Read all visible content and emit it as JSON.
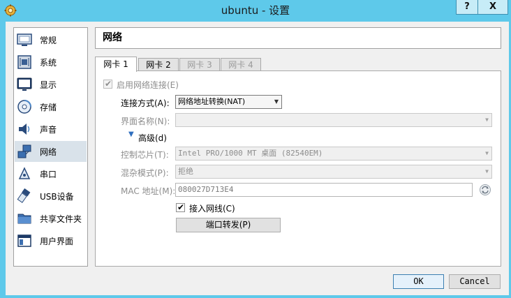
{
  "window": {
    "title": "ubuntu - 设置",
    "help_label": "?",
    "close_label": "X"
  },
  "sidebar": {
    "items": [
      {
        "label": "常规",
        "icon": "general-icon"
      },
      {
        "label": "系统",
        "icon": "system-icon"
      },
      {
        "label": "显示",
        "icon": "display-icon"
      },
      {
        "label": "存储",
        "icon": "storage-icon"
      },
      {
        "label": "声音",
        "icon": "audio-icon"
      },
      {
        "label": "网络",
        "icon": "network-icon",
        "selected": true
      },
      {
        "label": "串口",
        "icon": "serial-port-icon"
      },
      {
        "label": "USB设备",
        "icon": "usb-icon"
      },
      {
        "label": "共享文件夹",
        "icon": "shared-folder-icon"
      },
      {
        "label": "用户界面",
        "icon": "user-interface-icon"
      }
    ]
  },
  "section": {
    "title": "网络"
  },
  "tabs": [
    {
      "label": "网卡 1",
      "active": true
    },
    {
      "label": "网卡 2",
      "active": false
    },
    {
      "label": "网卡 3",
      "disabled": true
    },
    {
      "label": "网卡 4",
      "disabled": true
    }
  ],
  "adapter": {
    "enable_label": "启用网络连接(E)",
    "enable_checked": true,
    "attached_label": "连接方式(A):",
    "attached_value": "网络地址转换(NAT)",
    "name_label": "界面名称(N):",
    "name_value": "",
    "advanced_label": "高级(d)",
    "chip_label": "控制芯片(T):",
    "chip_value": "Intel PRO/1000 MT 桌面 (82540EM)",
    "promisc_label": "混杂模式(P):",
    "promisc_value": "拒绝",
    "mac_label": "MAC 地址(M):",
    "mac_value": "080027D713E4",
    "cable_label": "接入网线(C)",
    "cable_checked": true,
    "port_forward_label": "端口转发(P)"
  },
  "footer": {
    "ok_label": "OK",
    "cancel_label": "Cancel"
  },
  "colors": {
    "titlebar": "#5ec9ea",
    "selected_item": "#d9e2ea"
  }
}
